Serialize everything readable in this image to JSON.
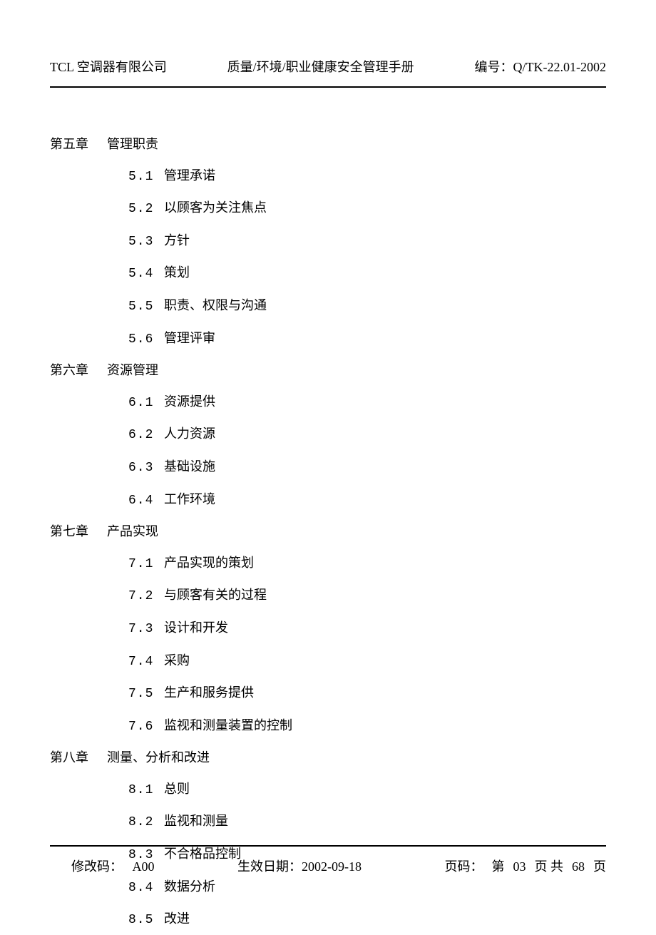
{
  "header": {
    "company": "TCL 空调器有限公司",
    "title": "质量/环境/职业健康安全管理手册",
    "code_label": "编号：",
    "code_value": "Q/TK-22.01-2002"
  },
  "chapters": [
    {
      "num": "第五章",
      "title": "管理职责",
      "sections": [
        {
          "num": "5.1",
          "title": "管理承诺"
        },
        {
          "num": "5.2",
          "title": "以顾客为关注焦点"
        },
        {
          "num": "5.3",
          "title": "方针"
        },
        {
          "num": "5.4",
          "title": "策划"
        },
        {
          "num": "5.5",
          "title": "职责、权限与沟通"
        },
        {
          "num": "5.6",
          "title": "管理评审"
        }
      ]
    },
    {
      "num": "第六章",
      "title": "资源管理",
      "sections": [
        {
          "num": "6.1",
          "title": "资源提供"
        },
        {
          "num": "6.2",
          "title": "人力资源"
        },
        {
          "num": "6.3",
          "title": "基础设施"
        },
        {
          "num": "6.4",
          "title": "工作环境"
        }
      ]
    },
    {
      "num": "第七章",
      "title": "产品实现",
      "sections": [
        {
          "num": "7.1",
          "title": "产品实现的策划"
        },
        {
          "num": "7.2",
          "title": "与顾客有关的过程"
        },
        {
          "num": "7.3",
          "title": "设计和开发"
        },
        {
          "num": "7.4",
          "title": "采购"
        },
        {
          "num": "7.5",
          "title": "生产和服务提供"
        },
        {
          "num": "7.6",
          "title": "监视和测量装置的控制"
        }
      ]
    },
    {
      "num": "第八章",
      "title": "测量、分析和改进",
      "sections": [
        {
          "num": "8.1",
          "title": "总则"
        },
        {
          "num": "8.2",
          "title": "监视和测量"
        },
        {
          "num": "8.3",
          "title": "不合格品控制"
        },
        {
          "num": "8.4",
          "title": "数据分析"
        },
        {
          "num": "8.5",
          "title": "改进"
        }
      ]
    }
  ],
  "footer": {
    "mod_label": "修改码：",
    "mod_value": "A00",
    "date_label": "生效日期：",
    "date_value": "2002-09-18",
    "page_label": "页码：",
    "page_prefix": "第",
    "page_current": "03",
    "page_mid": "页 共",
    "page_total": "68",
    "page_suffix": "页"
  }
}
